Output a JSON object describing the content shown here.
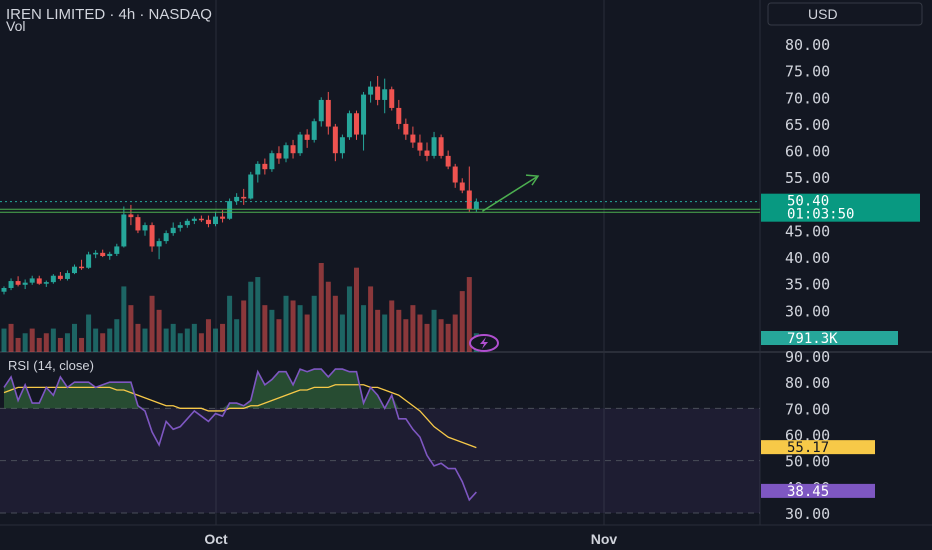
{
  "header": {
    "title": "IREN LIMITED · 4h · NASDAQ",
    "vol_label": "Vol",
    "currency_button": "USD"
  },
  "time_axis": [
    "Oct",
    "Nov"
  ],
  "price_axis": {
    "min": 25,
    "max": 80,
    "ticks": [
      "80.00",
      "75.00",
      "70.00",
      "65.00",
      "60.00",
      "55.00",
      "50.00",
      "45.00",
      "40.00",
      "35.00",
      "30.00",
      "25.00"
    ]
  },
  "last_price": {
    "price": "50.40",
    "countdown": "01:03:50",
    "value": 50.4
  },
  "volume_badge": "791.3K",
  "support_line": 48.6,
  "projection": {
    "from": 48.6,
    "to": 55.2
  },
  "colors": {
    "up": "#26a69a",
    "down": "#ef5350",
    "rsi": "#7e57c2",
    "rsi_ma": "#f7c948",
    "projection": "#4caf50",
    "bg": "#131722"
  },
  "rsi": {
    "label": "RSI (14, close)",
    "value_badge": "38.45",
    "ma_badge": "55.17",
    "min": 26,
    "max": 90,
    "ticks": [
      "90.00",
      "80.00",
      "70.00",
      "60.00",
      "50.00",
      "40.00",
      "30.00"
    ],
    "overbought": 70,
    "oversold": 30,
    "mid": 50
  },
  "chart_data": {
    "type": "candlestick",
    "title": "IREN LIMITED · 4h · NASDAQ",
    "candles": [
      [
        33.5,
        34.5,
        33.0,
        34.2
      ],
      [
        34.2,
        36.0,
        33.8,
        35.5
      ],
      [
        35.5,
        36.4,
        34.5,
        34.8
      ],
      [
        34.8,
        35.8,
        34.0,
        35.2
      ],
      [
        35.2,
        36.5,
        34.8,
        36.0
      ],
      [
        36.0,
        36.5,
        34.8,
        35.0
      ],
      [
        35.0,
        35.6,
        34.4,
        35.3
      ],
      [
        35.3,
        36.8,
        35.0,
        36.5
      ],
      [
        36.5,
        37.2,
        35.6,
        35.9
      ],
      [
        35.9,
        37.5,
        35.6,
        37.0
      ],
      [
        37.0,
        38.6,
        36.8,
        38.2
      ],
      [
        38.2,
        39.5,
        37.6,
        38.0
      ],
      [
        38.0,
        41.0,
        37.8,
        40.5
      ],
      [
        40.5,
        41.3,
        39.8,
        40.8
      ],
      [
        40.8,
        41.4,
        40.0,
        40.2
      ],
      [
        40.2,
        41.0,
        39.5,
        40.6
      ],
      [
        40.6,
        42.5,
        40.2,
        42.0
      ],
      [
        42.0,
        49.5,
        41.8,
        48.0
      ],
      [
        48.0,
        49.8,
        46.0,
        47.5
      ],
      [
        47.5,
        48.0,
        44.5,
        45.0
      ],
      [
        45.0,
        46.5,
        44.0,
        46.0
      ],
      [
        46.0,
        46.5,
        41.0,
        42.0
      ],
      [
        42.0,
        43.5,
        39.6,
        43.0
      ],
      [
        43.0,
        45.0,
        42.5,
        44.5
      ],
      [
        44.5,
        46.5,
        44.0,
        45.5
      ],
      [
        45.5,
        46.6,
        44.8,
        46.0
      ],
      [
        46.0,
        47.2,
        45.5,
        46.8
      ],
      [
        46.8,
        47.6,
        46.2,
        47.2
      ],
      [
        47.2,
        47.8,
        46.6,
        47.0
      ],
      [
        47.0,
        47.8,
        45.6,
        46.2
      ],
      [
        46.2,
        48.5,
        45.8,
        47.6
      ],
      [
        47.6,
        48.8,
        46.5,
        47.2
      ],
      [
        47.2,
        51.0,
        47.0,
        50.5
      ],
      [
        50.5,
        52.0,
        49.8,
        51.3
      ],
      [
        51.3,
        52.8,
        49.8,
        51.0
      ],
      [
        51.0,
        56.0,
        50.8,
        55.5
      ],
      [
        55.5,
        58.0,
        54.0,
        57.5
      ],
      [
        57.5,
        58.5,
        55.5,
        56.5
      ],
      [
        56.5,
        60.0,
        56.0,
        59.5
      ],
      [
        59.5,
        60.8,
        57.5,
        58.5
      ],
      [
        58.5,
        61.5,
        57.8,
        61.0
      ],
      [
        61.0,
        62.0,
        58.5,
        59.5
      ],
      [
        59.5,
        63.5,
        59.0,
        63.0
      ],
      [
        63.0,
        64.0,
        60.5,
        62.0
      ],
      [
        62.0,
        66.0,
        61.5,
        65.5
      ],
      [
        65.5,
        70.0,
        64.5,
        69.5
      ],
      [
        69.5,
        71.0,
        63.0,
        64.5
      ],
      [
        64.5,
        65.0,
        58.0,
        59.5
      ],
      [
        59.5,
        63.0,
        58.5,
        62.5
      ],
      [
        62.5,
        67.5,
        62.0,
        67.0
      ],
      [
        67.0,
        67.5,
        62.0,
        63.0
      ],
      [
        63.0,
        71.0,
        60.0,
        70.5
      ],
      [
        70.5,
        73.0,
        69.0,
        72.0
      ],
      [
        72.0,
        74.0,
        68.5,
        69.5
      ],
      [
        69.5,
        73.5,
        67.0,
        71.5
      ],
      [
        71.5,
        72.0,
        67.5,
        68.0
      ],
      [
        68.0,
        69.5,
        64.0,
        65.0
      ],
      [
        65.0,
        66.0,
        62.0,
        63.0
      ],
      [
        63.0,
        64.5,
        60.5,
        61.5
      ],
      [
        61.5,
        63.0,
        59.0,
        60.0
      ],
      [
        60.0,
        61.5,
        58.0,
        59.0
      ],
      [
        59.0,
        63.5,
        58.5,
        62.5
      ],
      [
        62.5,
        63.0,
        58.5,
        59.0
      ],
      [
        59.0,
        60.0,
        56.5,
        57.0
      ],
      [
        57.0,
        57.5,
        53.0,
        54.0
      ],
      [
        54.0,
        54.8,
        52.0,
        52.5
      ],
      [
        52.5,
        57.0,
        48.5,
        49.0
      ],
      [
        49.0,
        51.0,
        48.5,
        50.4
      ]
    ],
    "volumes": [
      [
        5,
        "up"
      ],
      [
        6,
        "down"
      ],
      [
        3,
        "down"
      ],
      [
        4,
        "up"
      ],
      [
        5,
        "down"
      ],
      [
        3,
        "down"
      ],
      [
        4,
        "down"
      ],
      [
        5,
        "up"
      ],
      [
        3,
        "down"
      ],
      [
        4,
        "up"
      ],
      [
        6,
        "up"
      ],
      [
        3,
        "down"
      ],
      [
        8,
        "up"
      ],
      [
        5,
        "up"
      ],
      [
        4,
        "down"
      ],
      [
        5,
        "up"
      ],
      [
        7,
        "up"
      ],
      [
        14,
        "up"
      ],
      [
        10,
        "down"
      ],
      [
        6,
        "down"
      ],
      [
        5,
        "up"
      ],
      [
        12,
        "down"
      ],
      [
        9,
        "down"
      ],
      [
        5,
        "up"
      ],
      [
        6,
        "up"
      ],
      [
        4,
        "up"
      ],
      [
        5,
        "up"
      ],
      [
        6,
        "up"
      ],
      [
        4,
        "down"
      ],
      [
        7,
        "down"
      ],
      [
        5,
        "up"
      ],
      [
        6,
        "down"
      ],
      [
        12,
        "up"
      ],
      [
        7,
        "up"
      ],
      [
        11,
        "down"
      ],
      [
        15,
        "up"
      ],
      [
        16,
        "up"
      ],
      [
        10,
        "down"
      ],
      [
        9,
        "up"
      ],
      [
        7,
        "down"
      ],
      [
        12,
        "up"
      ],
      [
        11,
        "down"
      ],
      [
        10,
        "up"
      ],
      [
        8,
        "down"
      ],
      [
        12,
        "up"
      ],
      [
        19,
        "down"
      ],
      [
        15,
        "down"
      ],
      [
        12,
        "down"
      ],
      [
        8,
        "up"
      ],
      [
        14,
        "up"
      ],
      [
        18,
        "down"
      ],
      [
        10,
        "up"
      ],
      [
        14,
        "down"
      ],
      [
        9,
        "down"
      ],
      [
        8,
        "up"
      ],
      [
        11,
        "down"
      ],
      [
        9,
        "down"
      ],
      [
        7,
        "down"
      ],
      [
        10,
        "down"
      ],
      [
        8,
        "down"
      ],
      [
        6,
        "down"
      ],
      [
        9,
        "up"
      ],
      [
        7,
        "down"
      ],
      [
        6,
        "down"
      ],
      [
        8,
        "down"
      ],
      [
        13,
        "down"
      ],
      [
        16,
        "down"
      ],
      [
        4,
        "up"
      ]
    ],
    "rsi_values": [
      78,
      82,
      73,
      79,
      72,
      72,
      78,
      75,
      82,
      78,
      80,
      80,
      80,
      78,
      79,
      80,
      80,
      80,
      80,
      71,
      69,
      61,
      56,
      65,
      62,
      63,
      66,
      69,
      67,
      65,
      68,
      67,
      72,
      72,
      71,
      73,
      84,
      79,
      81,
      84,
      84,
      79,
      85,
      84,
      85,
      85,
      82,
      85,
      85,
      84,
      84,
      72,
      78,
      75,
      70,
      75,
      66,
      66,
      62,
      59,
      52,
      48,
      49,
      47,
      47,
      42,
      35,
      38
    ],
    "rsi_ma_values": [
      76,
      77,
      78,
      78,
      78,
      78,
      78,
      78,
      78,
      78,
      78,
      78,
      78,
      78,
      78,
      78,
      77,
      77,
      76,
      75,
      74,
      73,
      72,
      71,
      71,
      70,
      70,
      70,
      70,
      69,
      69,
      69,
      70,
      70,
      70,
      71,
      71,
      72,
      73,
      74,
      75,
      76,
      77,
      77,
      78,
      78,
      78,
      79,
      79,
      79,
      79,
      79,
      78,
      78,
      77,
      76,
      75,
      73,
      71,
      69,
      66,
      63,
      61,
      59,
      58,
      57,
      56,
      55
    ]
  }
}
